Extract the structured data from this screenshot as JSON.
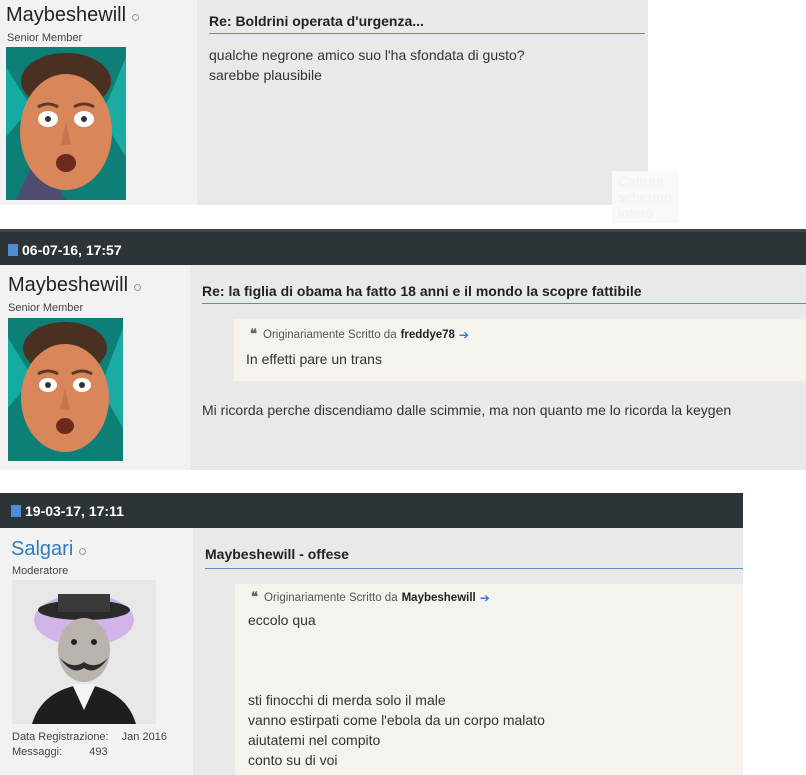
{
  "posts": [
    {
      "username": "Maybeshewill",
      "user_title": "Senior Member",
      "title": "Re: Boldrini operata d'urgenza...",
      "body": [
        "qualche negrone amico suo l'ha sfondata di gusto?",
        "sarebbe plausibile"
      ],
      "ghost_text": "Cattura schermo intero"
    },
    {
      "date": "06-07-16, 17:57",
      "username": "Maybeshewill",
      "user_title": "Senior Member",
      "title": "Re: la figlia di obama ha fatto 18 anni e il mondo la scopre fattibile",
      "quote": {
        "prefix": "Originariamente Scritto da",
        "author": "freddye78",
        "text": "In effetti pare un trans"
      },
      "body": [
        "Mi ricorda perche discendiamo dalle scimmie, ma non quanto me lo ricorda la keygen"
      ]
    },
    {
      "date": "19-03-17, 17:11",
      "username": "Salgari",
      "user_title": "Moderatore",
      "join_label": "Data Registrazione:",
      "join_value": "Jan 2016",
      "posts_label": "Messaggi:",
      "posts_value": "493",
      "title": "Maybeshewill - offese",
      "quote": {
        "prefix": "Originariamente Scritto da",
        "author": "Maybeshewill",
        "lines": [
          "eccolo qua",
          "",
          "",
          "",
          "sti finocchi di merda solo il male",
          "vanno estirpati come l'ebola da un corpo malato",
          "aiutatemi nel compito",
          "conto su di voi"
        ]
      }
    }
  ],
  "colors": {
    "date_bar": "#2c3438",
    "accent": "#4e8ed2",
    "moderator_name": "#2e7bc4"
  }
}
